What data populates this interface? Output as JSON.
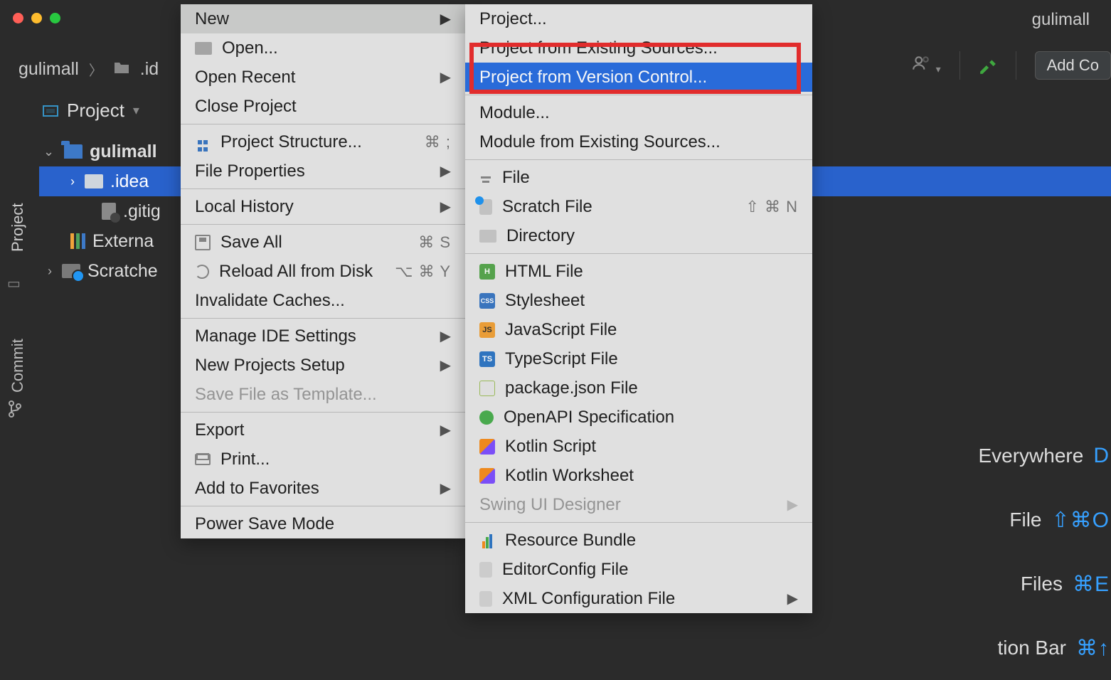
{
  "topbar": {
    "project_name": "gulimall"
  },
  "toolbar": {
    "add_config_label": "Add Co"
  },
  "breadcrumb": {
    "root": "gulimall",
    "folder": ".id"
  },
  "project_panel": {
    "title": "Project"
  },
  "tree": {
    "root": "gulimall",
    "idea": ".idea",
    "gitignore": ".gitig",
    "external": "Externa",
    "scratches": "Scratche"
  },
  "menu1": {
    "new": "New",
    "open": "Open...",
    "open_recent": "Open Recent",
    "close_project": "Close Project",
    "project_structure": "Project Structure...",
    "project_structure_sc": "⌘ ;",
    "file_properties": "File Properties",
    "local_history": "Local History",
    "save_all": "Save All",
    "save_all_sc": "⌘ S",
    "reload": "Reload All from Disk",
    "reload_sc": "⌥ ⌘ Y",
    "invalidate": "Invalidate Caches...",
    "manage_ide": "Manage IDE Settings",
    "new_projects_setup": "New Projects Setup",
    "save_template": "Save File as Template...",
    "export": "Export",
    "print": "Print...",
    "add_favorites": "Add to Favorites",
    "power_save": "Power Save Mode"
  },
  "menu2": {
    "project": "Project...",
    "project_existing": "Project from Existing Sources...",
    "project_vcs": "Project from Version Control...",
    "module": "Module...",
    "module_existing": "Module from Existing Sources...",
    "file": "File",
    "scratch_file": "Scratch File",
    "scratch_file_sc": "⇧ ⌘ N",
    "directory": "Directory",
    "html_file": "HTML File",
    "stylesheet": "Stylesheet",
    "js_file": "JavaScript File",
    "ts_file": "TypeScript File",
    "package_json": "package.json File",
    "openapi": "OpenAPI Specification",
    "kotlin_script": "Kotlin Script",
    "kotlin_worksheet": "Kotlin Worksheet",
    "swing": "Swing UI Designer",
    "resource_bundle": "Resource Bundle",
    "editorconfig": "EditorConfig File",
    "xml_config": "XML Configuration File"
  },
  "hints": {
    "everywhere": "Everywhere",
    "everywhere_sc": "D",
    "file": "File",
    "file_sc": "⇧⌘O",
    "files": "Files",
    "files_sc": "⌘E",
    "bar": "tion Bar",
    "bar_sc": "⌘↑"
  },
  "gutter": {
    "project": "Project",
    "commit": "Commit"
  }
}
